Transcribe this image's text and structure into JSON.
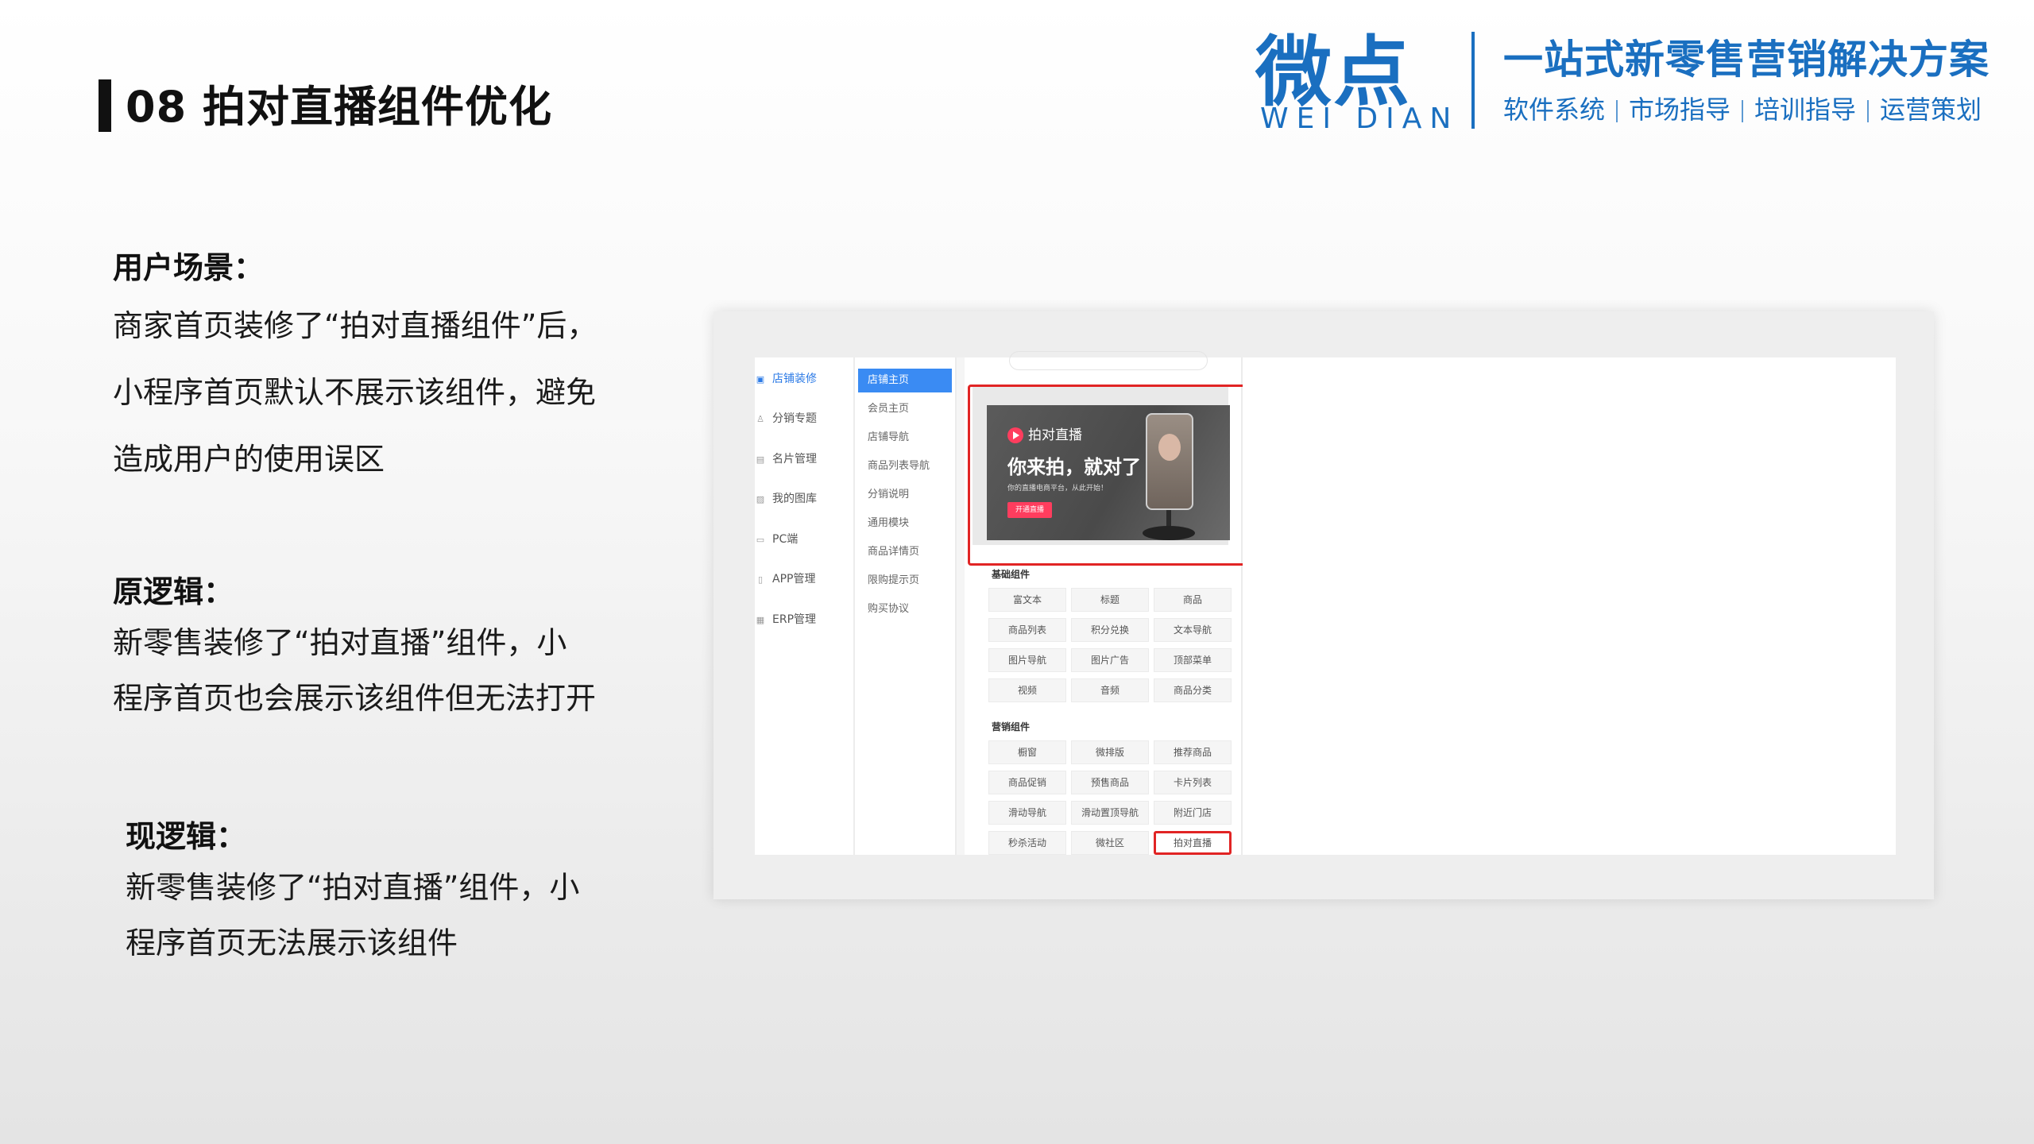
{
  "header": {
    "title": "08 拍对直播组件优化",
    "brand_logo": "微点",
    "brand_latin": "WEI DIAN",
    "brand_slogan": "一站式新零售营销解决方案",
    "brand_services": [
      "软件系统",
      "市场指导",
      "培训指导",
      "运营策划"
    ],
    "brand_color": "#1a6fc0"
  },
  "sections": {
    "scenario": {
      "heading": "用户场景：",
      "lines": [
        "商家首页装修了“拍对直播组件”后，",
        "小程序首页默认不展示该组件，避免",
        "造成用户的使用误区"
      ]
    },
    "old_logic": {
      "heading": "原逻辑：",
      "lines": [
        "新零售装修了“拍对直播”组件，小",
        "程序首页也会展示该组件但无法打开"
      ]
    },
    "new_logic": {
      "heading": "现逻辑：",
      "lines": [
        "新零售装修了“拍对直播”组件，小",
        "程序首页无法展示该组件"
      ]
    }
  },
  "screenshot": {
    "nav": [
      {
        "icon": "shop-icon",
        "glyph": "▣",
        "label": "店铺装修",
        "active": true
      },
      {
        "icon": "distribution-icon",
        "glyph": "♙",
        "label": "分销专题",
        "active": false
      },
      {
        "icon": "card-icon",
        "glyph": "▤",
        "label": "名片管理",
        "active": false
      },
      {
        "icon": "gallery-icon",
        "glyph": "▨",
        "label": "我的图库",
        "active": false
      },
      {
        "icon": "pc-icon",
        "glyph": "▭",
        "label": "PC端",
        "active": false
      },
      {
        "icon": "app-icon",
        "glyph": "▯",
        "label": "APP管理",
        "active": false
      },
      {
        "icon": "erp-icon",
        "glyph": "▦",
        "label": "ERP管理",
        "active": false
      }
    ],
    "subnav": [
      {
        "label": "店铺主页",
        "active": true
      },
      {
        "label": "会员主页",
        "active": false
      },
      {
        "label": "店铺导航",
        "active": false
      },
      {
        "label": "商品列表导航",
        "active": false
      },
      {
        "label": "分销说明",
        "active": false
      },
      {
        "label": "通用模块",
        "active": false
      },
      {
        "label": "商品详情页",
        "active": false
      },
      {
        "label": "限购提示页",
        "active": false
      },
      {
        "label": "购买协议",
        "active": false
      }
    ],
    "banner": {
      "app_name": "拍对直播",
      "headline": "你来拍，就对了",
      "subline": "你的直播电商平台，从此开始！",
      "button": "开通直播"
    },
    "basic_group": {
      "title": "基础组件",
      "items": [
        "富文本",
        "标题",
        "商品",
        "商品列表",
        "积分兑换",
        "文本导航",
        "图片导航",
        "图片广告",
        "顶部菜单",
        "视频",
        "音频",
        "商品分类"
      ]
    },
    "marketing_group": {
      "title": "营销组件",
      "items": [
        "橱窗",
        "微排版",
        "推荐商品",
        "商品促销",
        "预售商品",
        "卡片列表",
        "滑动导航",
        "滑动置顶导航",
        "附近门店",
        "秒杀活动",
        "微社区",
        "拍对直播"
      ],
      "highlighted": "拍对直播"
    },
    "highlight_color": "#e12424"
  }
}
